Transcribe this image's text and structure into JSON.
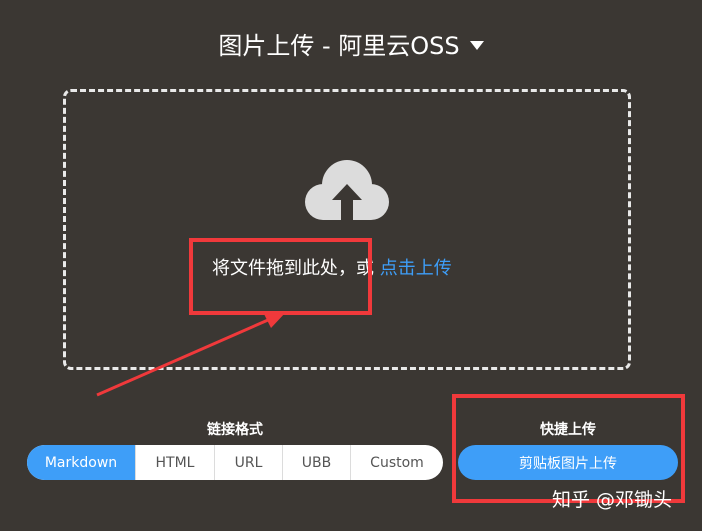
{
  "header": {
    "title": "图片上传 - 阿里云OSS",
    "dropdown_icon": "caret-down-icon"
  },
  "dropzone": {
    "icon": "cloud-upload-icon",
    "drag_text": "将文件拖到此处，或 ",
    "click_link": "点击上传"
  },
  "link_format": {
    "label": "链接格式",
    "options": [
      "Markdown",
      "HTML",
      "URL",
      "UBB",
      "Custom"
    ],
    "selected": "Markdown"
  },
  "quick_upload": {
    "label": "快捷上传",
    "button": "剪贴板图片上传"
  },
  "watermark": "知乎 @邓锄头",
  "colors": {
    "background": "#3b3733",
    "accent": "#3e9ef8",
    "annotation": "#f0393b"
  }
}
